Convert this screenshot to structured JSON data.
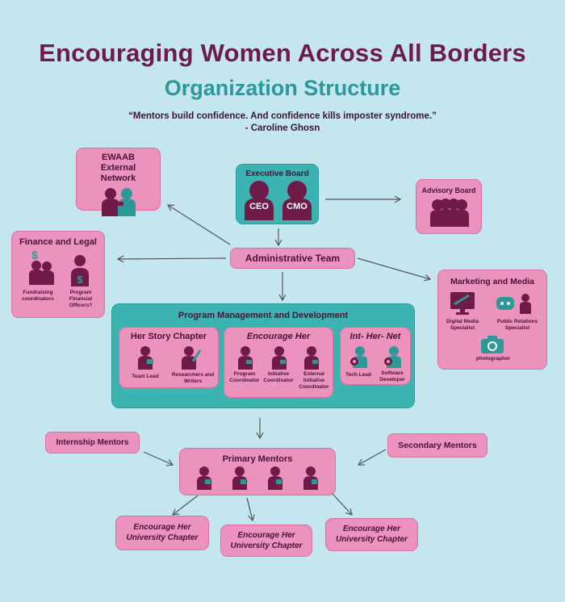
{
  "header": {
    "title": "Encouraging Women Across All Borders",
    "subtitle": "Organization Structure",
    "quote_line1": "“Mentors build confidence. And confidence kills imposter syndrome.”",
    "quote_line2": "- Caroline Ghosn"
  },
  "nodes": {
    "external_network": "EWAAB External Network",
    "executive_board": "Executive Board",
    "ceo": "CEO",
    "cmo": "CMO",
    "advisory_board": "Advisory Board",
    "finance_legal": "Finance and Legal",
    "fundraising": "Fundraising coordinators",
    "program_financial": "Program Financial Officers?",
    "administrative_team": "Administrative Team",
    "marketing_media": "Marketing and Media",
    "digital_media": "Digital Media Specialist",
    "public_relations": "Public Relations Specialist",
    "photographer": "photographer",
    "program_mgmt": "Program Management and Development",
    "her_story": "Her Story Chapter",
    "team_lead": "Team Lead",
    "researchers": "Researchers and Writers",
    "encourage_her": "Encourage Her",
    "program_coord": "Program Coordinator",
    "initiative_coord": "Initiative Coordinator",
    "external_initiative": "External Initiative Coordinator",
    "int_her_net": "Int- Her- Net",
    "tech_lead": "Tech Lead",
    "software_dev": "Software Developer",
    "internship_mentors": "Internship Mentors",
    "primary_mentors": "Primary Mentors",
    "secondary_mentors": "Secondary Mentors",
    "chapter1": "Encourage Her University Chapter",
    "chapter2": "Encourage Her University Chapter",
    "chapter3": "Encourage Her University Chapter"
  },
  "colors": {
    "background": "#c4e6ee",
    "pink": "#eb93bd",
    "teal": "#3bb3b1",
    "maroon": "#6e1b48"
  }
}
